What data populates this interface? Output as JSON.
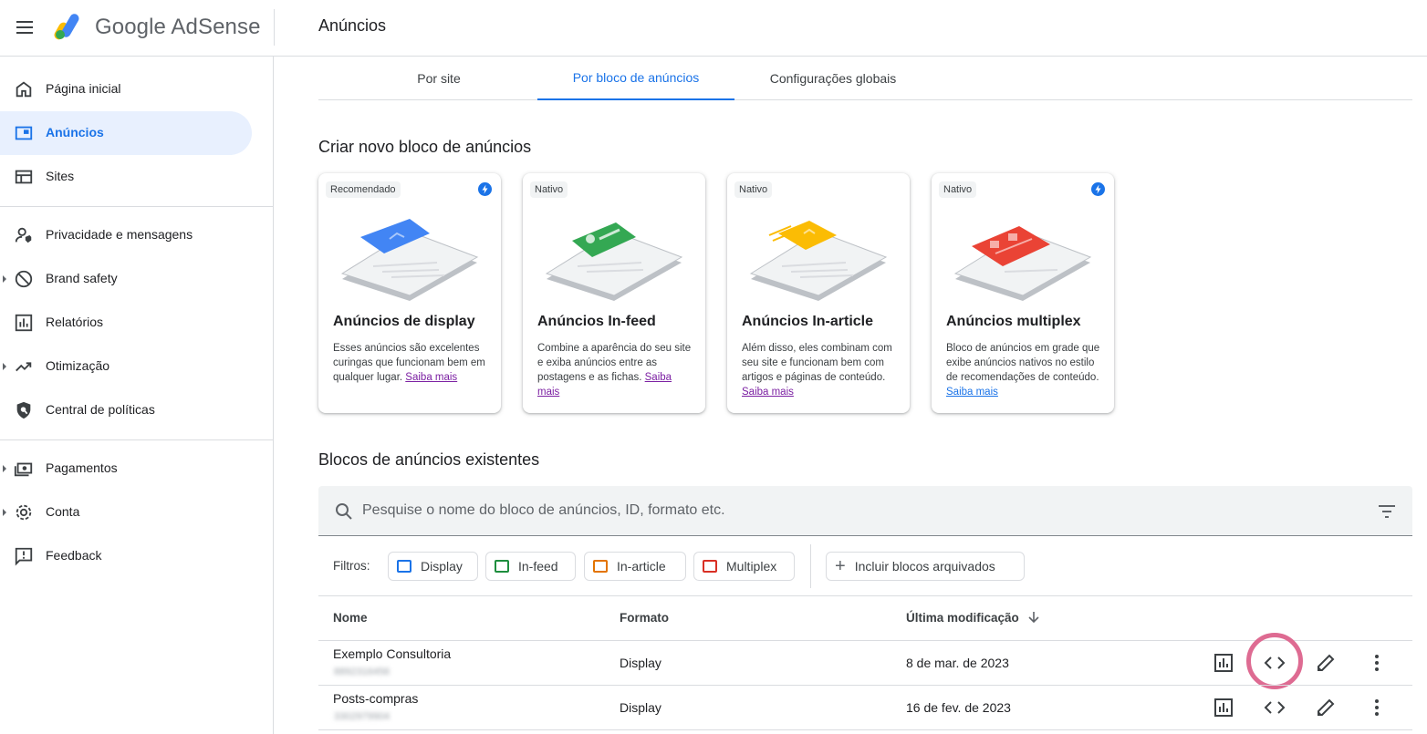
{
  "header": {
    "brand": "Google AdSense",
    "page_title": "Anúncios"
  },
  "sidebar": {
    "items": [
      {
        "label": "Página inicial",
        "icon": "home-icon"
      },
      {
        "label": "Anúncios",
        "icon": "ads-icon",
        "active": true
      },
      {
        "label": "Sites",
        "icon": "sites-icon"
      },
      {
        "label": "Privacidade e mensagens",
        "icon": "privacy-icon"
      },
      {
        "label": "Brand safety",
        "icon": "block-icon",
        "expandable": true
      },
      {
        "label": "Relatórios",
        "icon": "reports-icon"
      },
      {
        "label": "Otimização",
        "icon": "trending-icon",
        "expandable": true
      },
      {
        "label": "Central de políticas",
        "icon": "policy-shield-icon"
      },
      {
        "label": "Pagamentos",
        "icon": "payments-icon",
        "expandable": true
      },
      {
        "label": "Conta",
        "icon": "gear-icon",
        "expandable": true
      },
      {
        "label": "Feedback",
        "icon": "feedback-icon"
      }
    ]
  },
  "tabs": [
    {
      "label": "Por site"
    },
    {
      "label": "Por bloco de anúncios",
      "active": true
    },
    {
      "label": "Configurações globais"
    }
  ],
  "create_section": {
    "title": "Criar novo bloco de anúncios",
    "cards": [
      {
        "badge": "Recomendado",
        "title": "Anúncios de display",
        "desc": "Esses anúncios são excelentes curingas que funcionam bem em qualquer lugar.",
        "link": "Saiba mais",
        "color": "#4285f4"
      },
      {
        "badge": "Nativo",
        "title": "Anúncios In-feed",
        "desc": "Combine a aparência do seu site e exiba anúncios entre as postagens e as fichas.",
        "link": "Saiba mais",
        "color": "#34a853"
      },
      {
        "badge": "Nativo",
        "title": "Anúncios In-article",
        "desc": "Além disso, eles combinam com seu site e funcionam bem com artigos e páginas de conteúdo.",
        "link": "Saiba mais",
        "color": "#fbbc04"
      },
      {
        "badge": "Nativo",
        "title": "Anúncios multiplex",
        "desc": "Bloco de anúncios em grade que exibe anúncios nativos no estilo de recomendações de conteúdo.",
        "link": "Saiba mais",
        "color": "#ea4335"
      }
    ]
  },
  "existing_section": {
    "title": "Blocos de anúncios existentes",
    "search_placeholder": "Pesquise o nome do bloco de anúncios, ID, formato etc.",
    "filters_label": "Filtros:",
    "filter_chips": [
      {
        "label": "Display",
        "color": "#1a73e8"
      },
      {
        "label": "In-feed",
        "color": "#1e8e3e"
      },
      {
        "label": "In-article",
        "color": "#e37400"
      },
      {
        "label": "Multiplex",
        "color": "#d93025"
      }
    ],
    "archived_chip": "Incluir blocos arquivados",
    "columns": [
      "Nome",
      "Formato",
      "Última modificação"
    ],
    "rows": [
      {
        "name": "Exemplo Consultoria",
        "id": "8892316456",
        "format": "Display",
        "modified": "8 de mar. de 2023"
      },
      {
        "name": "Posts-compras",
        "id": "3302979904",
        "format": "Display",
        "modified": "16 de fev. de 2023"
      }
    ]
  },
  "colors": {
    "accent": "#1a73e8",
    "highlight_ring": "#de6b92"
  }
}
